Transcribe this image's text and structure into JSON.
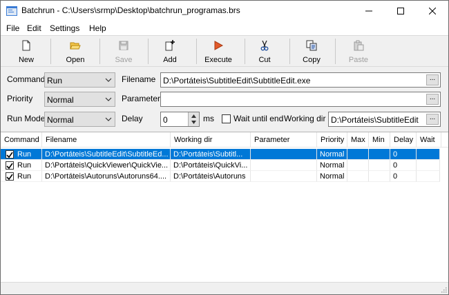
{
  "window": {
    "title": "Batchrun - C:\\Users\\srmp\\Desktop\\batchrun_programas.brs"
  },
  "menu": [
    "File",
    "Edit",
    "Settings",
    "Help"
  ],
  "toolbar": {
    "new": "New",
    "open": "Open",
    "save": "Save",
    "add": "Add",
    "execute": "Execute",
    "cut": "Cut",
    "copy": "Copy",
    "paste": "Paste"
  },
  "form": {
    "command_label": "Command",
    "command_value": "Run",
    "priority_label": "Priority",
    "priority_value": "Normal",
    "runmode_label": "Run Mode",
    "runmode_value": "Normal",
    "filename_label": "Filename",
    "filename_value": "D:\\Portáteis\\SubtitleEdit\\SubtitleEdit.exe",
    "parameter_label": "Parameter",
    "parameter_value": "",
    "delay_label": "Delay",
    "delay_value": "0",
    "delay_unit": "ms",
    "wait_label": "Wait until end",
    "workdir_label": "Working dir",
    "workdir_value": "D:\\Portáteis\\SubtitleEdit",
    "browse_label": "..."
  },
  "table": {
    "columns": [
      "Command",
      "Filename",
      "Working dir",
      "Parameter",
      "Priority",
      "Max",
      "Min",
      "Delay",
      "Wait"
    ],
    "rows": [
      {
        "command": "Run",
        "filename": "D:\\Portáteis\\SubtitleEdit\\SubtitleEd...",
        "workdir": "D:\\Portáteis\\Subtitl...",
        "parameter": "",
        "priority": "Normal",
        "max": "",
        "min": "",
        "delay": "0",
        "wait": ""
      },
      {
        "command": "Run",
        "filename": "D:\\Portáteis\\QuickViewer\\QuickVie...",
        "workdir": "D:\\Portáteis\\QuickVi...",
        "parameter": "",
        "priority": "Normal",
        "max": "",
        "min": "",
        "delay": "0",
        "wait": ""
      },
      {
        "command": "Run",
        "filename": "D:\\Portáteis\\Autoruns\\Autoruns64....",
        "workdir": "D:\\Portáteis\\Autoruns",
        "parameter": "",
        "priority": "Normal",
        "max": "",
        "min": "",
        "delay": "0",
        "wait": ""
      }
    ]
  },
  "colors": {
    "selection": "#0078d7",
    "execute_icon": "#e25a2a"
  }
}
